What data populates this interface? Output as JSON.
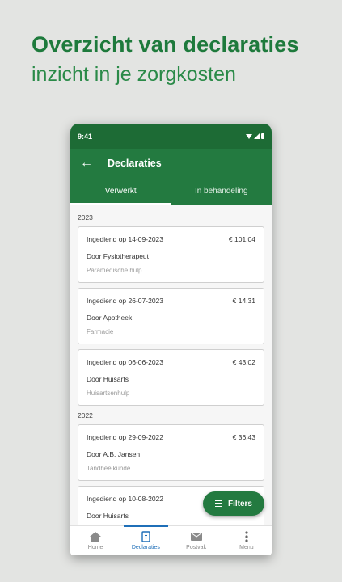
{
  "hero": {
    "title": "Overzicht van declaraties",
    "subtitle": "inzicht in je zorgkosten"
  },
  "status_bar": {
    "time": "9:41"
  },
  "app_bar": {
    "title": "Declaraties"
  },
  "tabs": [
    {
      "label": "Verwerkt",
      "active": true
    },
    {
      "label": "In behandeling",
      "active": false
    }
  ],
  "groups": [
    {
      "year": "2023",
      "claims": [
        {
          "date": "Ingediend op 14-09-2023",
          "amount": "€ 101,04",
          "by": "Door Fysiotherapeut",
          "category": "Paramedische hulp"
        },
        {
          "date": "Ingediend op 26-07-2023",
          "amount": "€ 14,31",
          "by": "Door Apotheek",
          "category": "Farmacie"
        },
        {
          "date": "Ingediend op 06-06-2023",
          "amount": "€ 43,02",
          "by": "Door Huisarts",
          "category": "Huisartsenhulp"
        }
      ]
    },
    {
      "year": "2022",
      "claims": [
        {
          "date": "Ingediend op 29-09-2022",
          "amount": "€ 36,43",
          "by": "Door A.B. Jansen",
          "category": "Tandheelkunde"
        },
        {
          "date": "Ingediend op 10-08-2022",
          "amount": "",
          "by": "Door Huisarts",
          "category": ""
        }
      ]
    }
  ],
  "fab": {
    "label": "Filters"
  },
  "bottom_nav": [
    {
      "label": "Home",
      "icon": "home-icon",
      "active": false
    },
    {
      "label": "Declaraties",
      "icon": "receipt-icon",
      "active": true
    },
    {
      "label": "Postvak",
      "icon": "mail-icon",
      "active": false
    },
    {
      "label": "Menu",
      "icon": "more-vertical-icon",
      "active": false
    }
  ],
  "colors": {
    "brand_green": "#237a40",
    "status_green": "#1d6b35",
    "active_blue": "#1f6fb8"
  }
}
